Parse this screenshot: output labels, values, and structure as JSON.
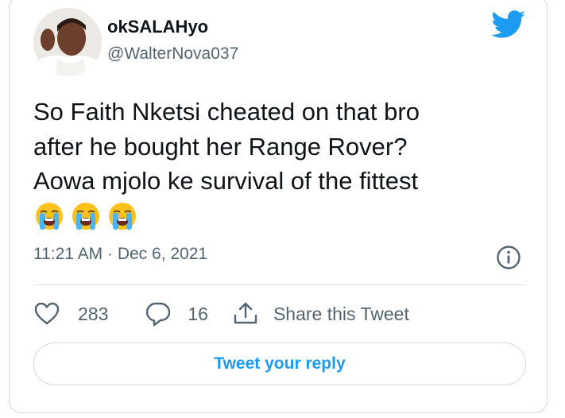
{
  "author": {
    "display_name": "okSALAHyo",
    "handle": "@WalterNova037"
  },
  "tweet": {
    "text": "So Faith Nketsi cheated on that bro\nafter he bought her Range Rover?\nAowa mjolo ke survival of the fittest",
    "emojis": [
      "loudly-crying-face",
      "loudly-crying-face",
      "loudly-crying-face"
    ],
    "timestamp": "11:21 AM · Dec 6, 2021"
  },
  "actions": {
    "like_count": "283",
    "reply_count": "16",
    "share_label": "Share this Tweet"
  },
  "reply_button_label": "Tweet your reply",
  "colors": {
    "brand_blue": "#1d9bf0",
    "secondary_text": "#536471",
    "border": "#cfd9de"
  },
  "icons": [
    "twitter-bird-icon",
    "info-icon",
    "heart-icon",
    "reply-bubble-icon",
    "share-icon"
  ]
}
